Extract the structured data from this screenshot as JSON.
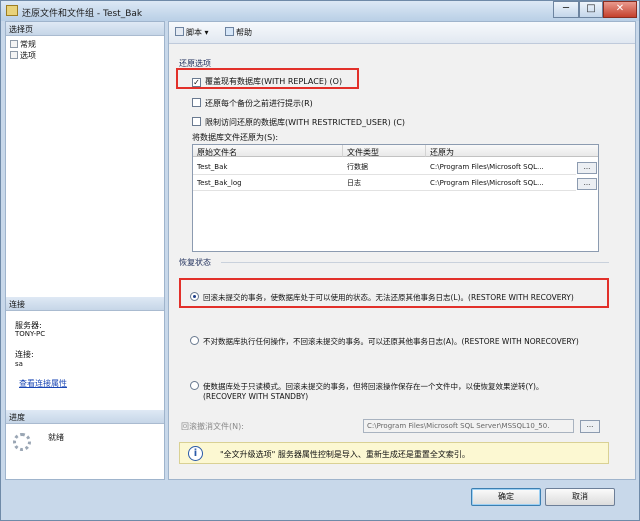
{
  "window": {
    "title": "还原文件和文件组 - Test_Bak",
    "minimize": "─",
    "maximize": "□",
    "close": "✕"
  },
  "left": {
    "select_page": "选择页",
    "pages": [
      {
        "label": "常规",
        "icon": "page-icon"
      },
      {
        "label": "选项",
        "icon": "page-icon"
      }
    ],
    "connection": {
      "header": "连接",
      "server_label": "服务器:",
      "server_value": "TONY-PC",
      "conn_label": "连接:",
      "conn_value": "sa",
      "view_props": "查看连接属性"
    },
    "progress": {
      "header": "进度",
      "status": "就绪"
    }
  },
  "toolbar": {
    "script": "脚本",
    "script_arrow": "▾",
    "help": "帮助"
  },
  "restore_options": {
    "title": "还原选项",
    "overwrite": "覆盖现有数据库(WITH REPLACE) (O)",
    "overwrite_checked": true,
    "prompt": "还原每个备份之前进行提示(R)",
    "restrict": "限制访问还原的数据库(WITH RESTRICTED_USER) (C)",
    "files_label": "将数据库文件还原为(S):"
  },
  "file_table": {
    "columns": [
      "原始文件名",
      "文件类型",
      "还原为"
    ],
    "rows": [
      {
        "name": "Test_Bak",
        "type": "行数据",
        "path": "C:\\Program Files\\Microsoft SQL...",
        "btn": "..."
      },
      {
        "name": "Test_Bak_log",
        "type": "日志",
        "path": "C:\\Program Files\\Microsoft SQL...",
        "btn": "..."
      }
    ]
  },
  "recovery": {
    "title": "恢复状态",
    "opt1": "回滚未提交的事务，使数据库处于可以使用的状态。无法还原其他事务日志(L)。(RESTORE WITH RECOVERY)",
    "opt2": "不对数据库执行任何操作，不回滚未提交的事务。可以还原其他事务日志(A)。(RESTORE WITH NORECOVERY)",
    "opt3_line1": "使数据库处于只读模式。回滚未提交的事务，但将回滚操作保存在一个文件中，以使恢复效果逆转(Y)。",
    "opt3_line2": "(RECOVERY WITH STANDBY)",
    "selected": 1,
    "rollback_label": "回滚撤消文件(N):",
    "rollback_value": "C:\\Program Files\\Microsoft SQL Server\\MSSQL10_50.",
    "rollback_btn": "..."
  },
  "info": {
    "icon": "i",
    "text": "\"全文升级选项\" 服务器属性控制是导入、重新生成还是重置全文索引。"
  },
  "buttons": {
    "ok": "确定",
    "cancel": "取消"
  }
}
